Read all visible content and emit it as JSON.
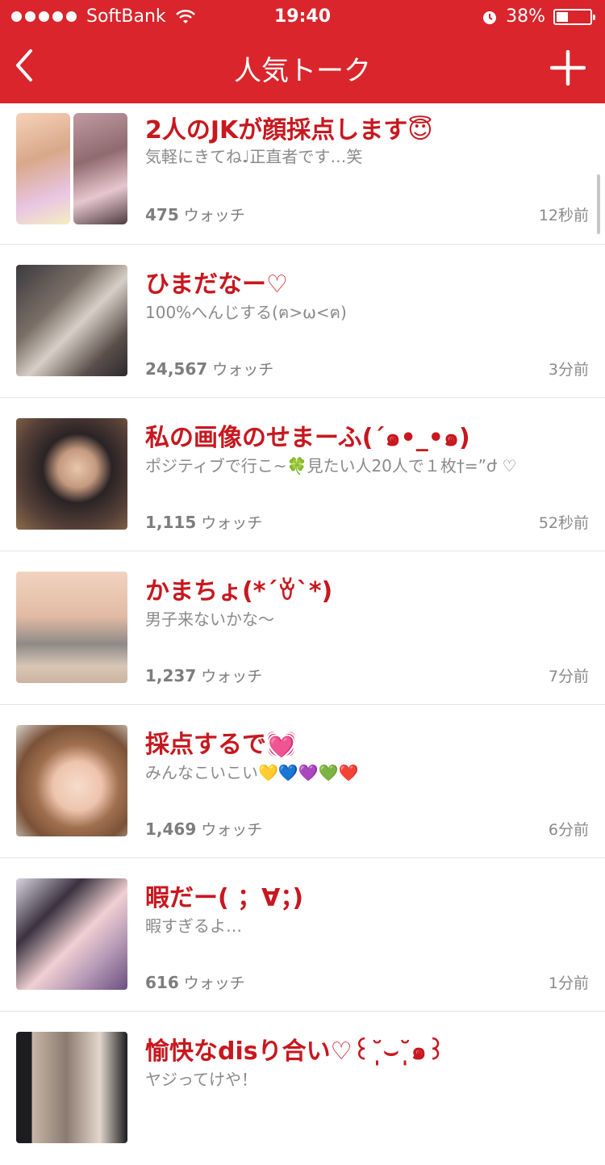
{
  "status": {
    "carrier": "SoftBank",
    "time": "19:40",
    "battery": "38%"
  },
  "header": {
    "title": "人気トーク"
  },
  "colors": {
    "accent": "#d9252b",
    "title_text": "#c8171e"
  },
  "watch_label": "ウォッチ",
  "items": [
    {
      "title": "2人のJKが顔採点します😇",
      "subtitle": "気軽にきてね♩正直者です…笑",
      "count": "475",
      "time": "12秒前"
    },
    {
      "title": "ひまだなー♡",
      "subtitle": "100%へんじする(ฅ>ω<ฅ)",
      "count": "24,567",
      "time": "3分前"
    },
    {
      "title": "私の画像のせまーふ(´๑•_•๑)",
      "subtitle": "ポジティブで行こ~🍀見たい人20人で１枚†=”ժ ♡",
      "count": "1,115",
      "time": "52秒前"
    },
    {
      "title": "かまちょ(*´ꈊ`*)",
      "subtitle": "男子来ないかな〜",
      "count": "1,237",
      "time": "7分前"
    },
    {
      "title": "採点するで💓",
      "subtitle": "みんなこいこい💛💙💜💚❤️",
      "count": "1,469",
      "time": "6分前"
    },
    {
      "title": "暇だー( ；∀；)",
      "subtitle": "暇すぎるよ…",
      "count": "616",
      "time": "1分前"
    },
    {
      "title": "愉快なdisり合い♡꒰˘̩̩̩⌣˘̩̩̩๑꒱",
      "subtitle": "ヤジってけや！",
      "count": "",
      "time": ""
    }
  ]
}
